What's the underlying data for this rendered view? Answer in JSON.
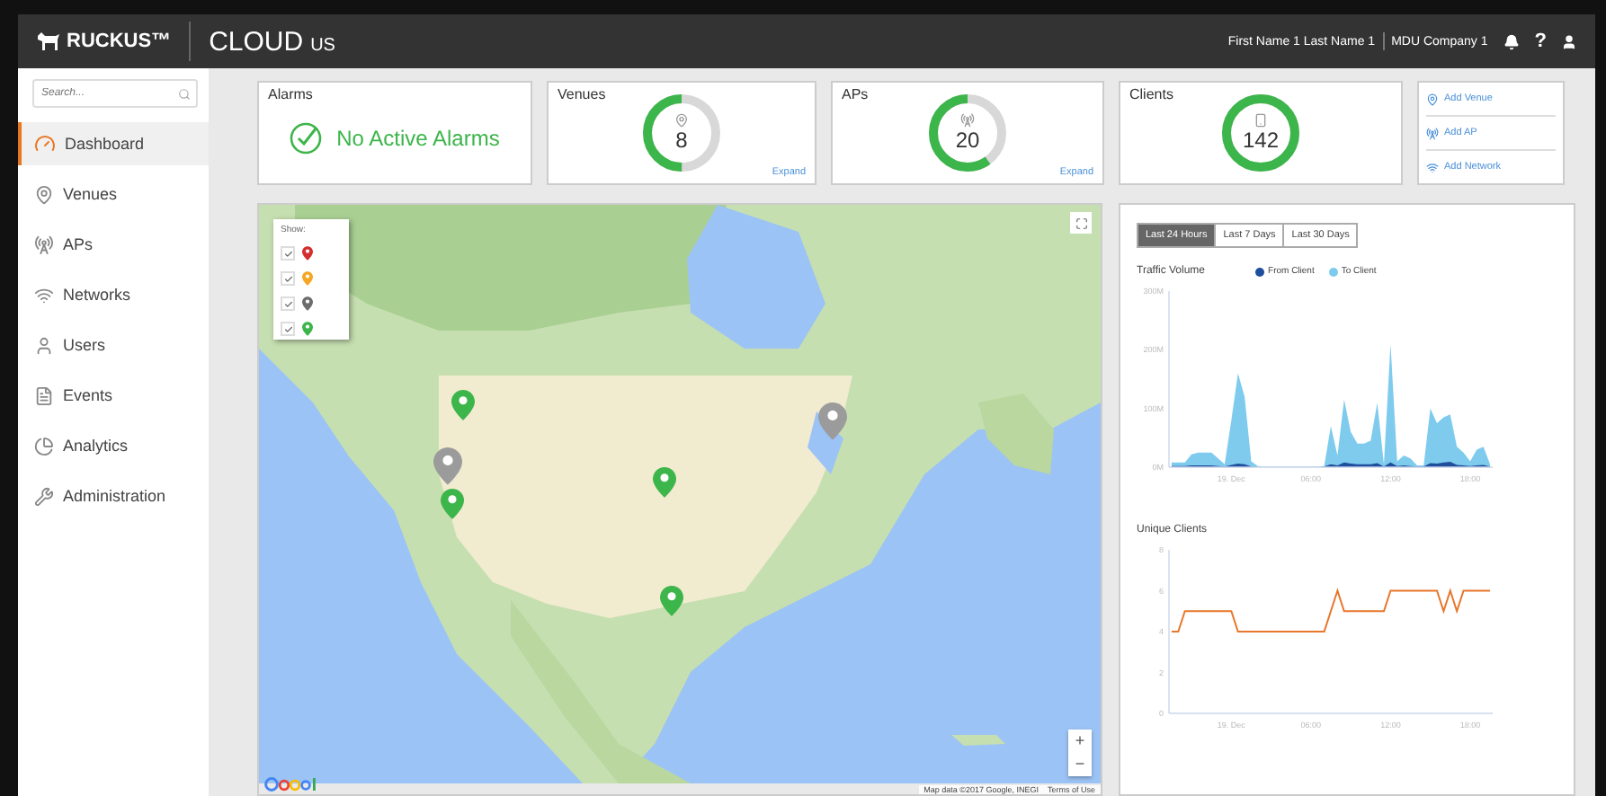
{
  "header": {
    "brand": "RUCKUS™",
    "product": "CLOUD",
    "region": "US",
    "user": "First Name 1 Last Name 1",
    "company": "MDU Company 1",
    "help": "?"
  },
  "sidebar": {
    "search": {
      "placeholder": "Search..."
    },
    "items": [
      {
        "label": "Dashboard",
        "kind": "dashboard",
        "selected": true
      },
      {
        "label": "Venues",
        "kind": "venues",
        "selected": false
      },
      {
        "label": "APs",
        "kind": "aps",
        "selected": false
      },
      {
        "label": "Networks",
        "kind": "networks",
        "selected": false
      },
      {
        "label": "Users",
        "kind": "users",
        "selected": false
      },
      {
        "label": "Events",
        "kind": "events",
        "selected": false
      },
      {
        "label": "Analytics",
        "kind": "analytics",
        "selected": false
      },
      {
        "label": "Administration",
        "kind": "administration",
        "selected": false
      }
    ]
  },
  "cards": [
    {
      "kind": "alarms",
      "title": "Alarms",
      "message": "No Active Alarms"
    },
    {
      "kind": "donut",
      "title": "Venues",
      "value": "8",
      "level": 0.5,
      "link": "Expand"
    },
    {
      "kind": "donut",
      "title": "APs",
      "value": "20",
      "level": 0.6,
      "link": "Expand"
    },
    {
      "kind": "donut",
      "title": "Clients",
      "value": "142",
      "level": 1
    }
  ],
  "actions": [
    {
      "kind": "venue",
      "label": "Add Venue"
    },
    {
      "kind": "ap",
      "label": "Add AP"
    },
    {
      "kind": "network",
      "label": "Add Network"
    }
  ],
  "map": {
    "legend_title": "Show:",
    "legend": [
      {
        "checked": true,
        "color": "#d32f2f"
      },
      {
        "checked": true,
        "color": "#f5a623"
      },
      {
        "checked": true,
        "color": "#6d6d6d"
      },
      {
        "checked": true,
        "color": "#3cb54a"
      }
    ],
    "zoom_in": "+",
    "zoom_out": "−",
    "attribution": "Map data ©2017 Google, INEGI",
    "terms": "Terms of Use"
  },
  "period_tabs": [
    {
      "label": "Last 24 Hours",
      "selected": true
    },
    {
      "label": "Last 7 Days",
      "selected": false
    },
    {
      "label": "Last 30 Days",
      "selected": false
    }
  ],
  "traffic": {
    "chart_data": {
      "type": "area",
      "title": "Traffic Volume",
      "x": [
        -4.5,
        -4,
        -3.5,
        -3,
        -2.5,
        -2,
        -1.5,
        -1,
        -0.5,
        0,
        0.5,
        1,
        1.5,
        2,
        2.5,
        3,
        3.5,
        4,
        4.5,
        5,
        5.5,
        6,
        6.5,
        7,
        7.5,
        8,
        8.5,
        9,
        9.5,
        10,
        10.5,
        11,
        11.5,
        12,
        12.5,
        13,
        13.5,
        14,
        14.5,
        15,
        15.5,
        16,
        16.5,
        17,
        17.5,
        18,
        18.5,
        19,
        19.5
      ],
      "series": [
        {
          "name": "To Client",
          "color": "#7ecbee",
          "values": [
            8,
            8,
            8,
            22,
            25,
            25,
            25,
            15,
            5,
            80,
            160,
            120,
            10,
            2,
            1,
            1,
            1,
            1,
            1,
            1,
            1,
            1,
            1,
            2,
            70,
            20,
            115,
            60,
            40,
            40,
            45,
            110,
            5,
            210,
            10,
            20,
            15,
            3,
            3,
            100,
            75,
            85,
            90,
            35,
            25,
            10,
            30,
            35,
            5
          ]
        },
        {
          "name": "From Client",
          "color": "#1f4e9c",
          "values": [
            2,
            2,
            2,
            3,
            3,
            3,
            3,
            2,
            1,
            4,
            6,
            5,
            1,
            0,
            0,
            0,
            0,
            0,
            0,
            0,
            0,
            0,
            0,
            1,
            5,
            3,
            8,
            6,
            5,
            5,
            5,
            7,
            1,
            8,
            2,
            3,
            2,
            1,
            1,
            7,
            6,
            8,
            9,
            4,
            3,
            2,
            3,
            4,
            1
          ]
        }
      ],
      "xlim": [
        -4.7,
        19.7
      ],
      "ylim": [
        0,
        300
      ],
      "xticks": [
        {
          "value": 0,
          "label": "19. Dec"
        },
        {
          "value": 6,
          "label": "06:00"
        },
        {
          "value": 12,
          "label": "12:00"
        },
        {
          "value": 18,
          "label": "18:00"
        }
      ],
      "yticks": [
        {
          "value": 0,
          "label": "0M"
        },
        {
          "value": 100,
          "label": "100M"
        },
        {
          "value": 200,
          "label": "200M"
        },
        {
          "value": 300,
          "label": "300M"
        }
      ]
    }
  },
  "clients": {
    "chart_data": {
      "type": "line",
      "title": "Unique Clients",
      "x": [
        -4.5,
        -4,
        -3.5,
        -3,
        -2.5,
        -2,
        -1.5,
        -1,
        -0.5,
        0,
        0.5,
        1,
        1.5,
        2,
        2.5,
        3,
        3.5,
        4,
        4.5,
        5,
        5.5,
        6,
        6.5,
        7,
        7.5,
        8,
        8.5,
        9,
        9.5,
        10,
        10.5,
        11,
        11.5,
        12,
        12.5,
        13,
        13.5,
        14,
        14.5,
        15,
        15.5,
        16,
        16.5,
        17,
        17.5,
        18,
        18.5,
        19,
        19.5
      ],
      "series": [
        {
          "color": "#e8762b",
          "values": [
            4,
            4,
            5,
            5,
            5,
            5,
            5,
            5,
            5,
            5,
            4,
            4,
            4,
            4,
            4,
            4,
            4,
            4,
            4,
            4,
            4,
            4,
            4,
            4,
            5,
            6,
            5,
            5,
            5,
            5,
            5,
            5,
            5,
            6,
            6,
            6,
            6,
            6,
            6,
            6,
            6,
            5,
            6,
            5,
            6,
            6,
            6,
            6,
            6
          ]
        }
      ],
      "xlim": [
        -4.7,
        19.7
      ],
      "ylim": [
        0,
        8
      ],
      "xticks": [
        {
          "value": 0,
          "label": "19. Dec"
        },
        {
          "value": 6,
          "label": "06:00"
        },
        {
          "value": 12,
          "label": "12:00"
        },
        {
          "value": 18,
          "label": "18:00"
        }
      ],
      "yticks": [
        0,
        2,
        4,
        6,
        8
      ]
    }
  }
}
